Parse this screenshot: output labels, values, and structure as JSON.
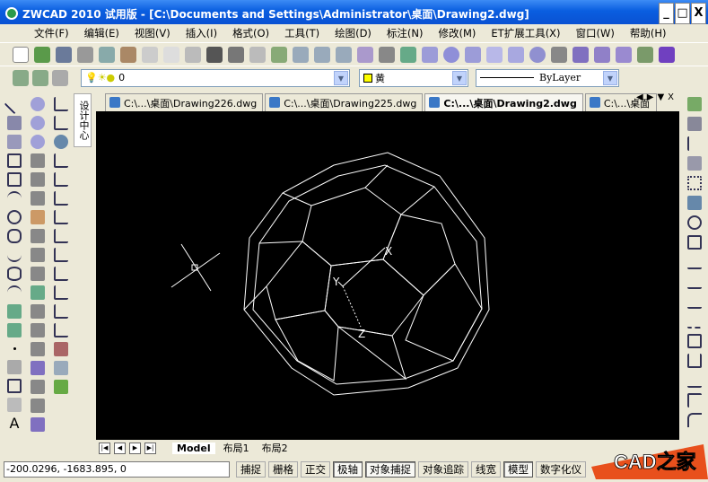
{
  "window": {
    "title": "ZWCAD 2010 试用版 - [C:\\Documents and Settings\\Administrator\\桌面\\Drawing2.dwg]",
    "controls": [
      "_",
      "□",
      "X"
    ]
  },
  "menu": [
    "文件(F)",
    "编辑(E)",
    "视图(V)",
    "插入(I)",
    "格式(O)",
    "工具(T)",
    "绘图(D)",
    "标注(N)",
    "修改(M)",
    "ET扩展工具(X)",
    "窗口(W)",
    "帮助(H)"
  ],
  "layer": {
    "value": "0",
    "color_value": "黄",
    "color_hex": "#ffff00",
    "linetype": "ByLayer"
  },
  "side_panel_label": "设计中心",
  "doc_tabs": [
    {
      "label": "C:\\...\\桌面\\Drawing226.dwg",
      "active": false
    },
    {
      "label": "C:\\...\\桌面\\Drawing225.dwg",
      "active": false
    },
    {
      "label": "C:\\...\\桌面\\Drawing2.dwg",
      "active": true
    },
    {
      "label": "C:\\...\\桌面",
      "active": false
    }
  ],
  "tab_controls": [
    "◀",
    "▶",
    "▼",
    "X"
  ],
  "axis_labels": {
    "x": "X",
    "y": "Y",
    "z": "Z"
  },
  "layout_tabs": [
    {
      "label": "Model",
      "active": true
    },
    {
      "label": "布局1",
      "active": false
    },
    {
      "label": "布局2",
      "active": false
    }
  ],
  "status": {
    "coordinates": "-200.0296,  -1683.895,  0",
    "buttons": [
      {
        "label": "捕捉",
        "on": false
      },
      {
        "label": "栅格",
        "on": false
      },
      {
        "label": "正交",
        "on": false
      },
      {
        "label": "极轴",
        "on": true
      },
      {
        "label": "对象捕捉",
        "on": true
      },
      {
        "label": "对象追踪",
        "on": false
      },
      {
        "label": "线宽",
        "on": false
      },
      {
        "label": "模型",
        "on": true
      },
      {
        "label": "数字化仪",
        "on": false
      }
    ]
  },
  "watermark": "CAD之家"
}
